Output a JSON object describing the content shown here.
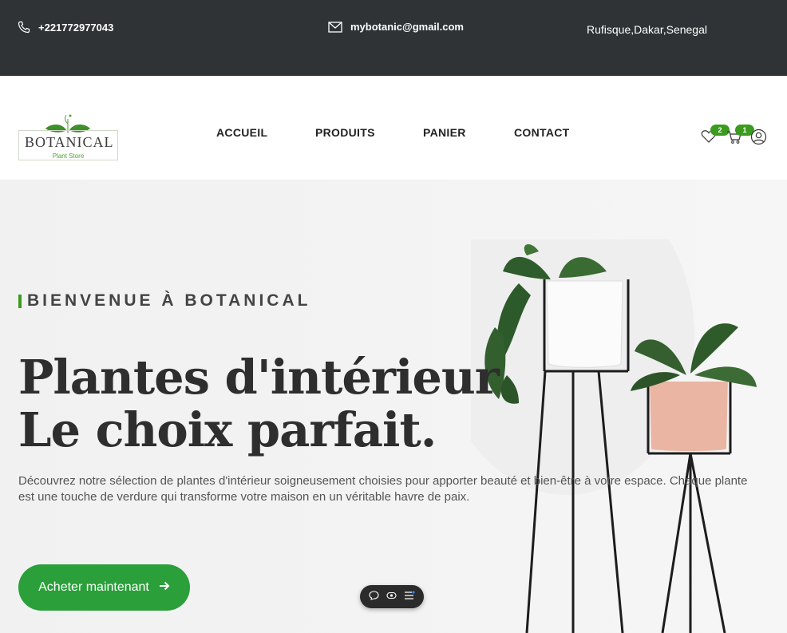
{
  "topbar": {
    "phone": "+221772977043",
    "email": "mybotanic@gmail.com",
    "location": "Rufisque,Dakar,Senegal"
  },
  "logo": {
    "name": "BOTANICAL",
    "tagline": "Plant Store"
  },
  "nav": {
    "items": [
      "ACCUEIL",
      "PRODUITS",
      "PANIER",
      "CONTACT"
    ]
  },
  "header_icons": {
    "wishlist_count": "2",
    "cart_count": "1"
  },
  "hero": {
    "eyebrow": "BIENVENUE À BOTANICAL",
    "headline_line1": "Plantes d'intérieur",
    "headline_line2": "Le choix parfait.",
    "description": "Découvrez notre sélection de plantes d'intérieur soigneusement choisies pour apporter beauté et bien-être à votre espace. Chaque plante est une touche de verdure qui transforme votre maison en un véritable havre de paix.",
    "cta_label": "Acheter maintenant"
  },
  "colors": {
    "topbar_bg": "#2f3336",
    "accent_green": "#2a9f3a",
    "badge_green": "#3c9a1f"
  },
  "icons": [
    "phone-icon",
    "mail-icon",
    "heart-icon",
    "cart-icon",
    "user-icon",
    "arrow-right-icon",
    "chat-icon",
    "eye-icon",
    "menu-icon"
  ]
}
